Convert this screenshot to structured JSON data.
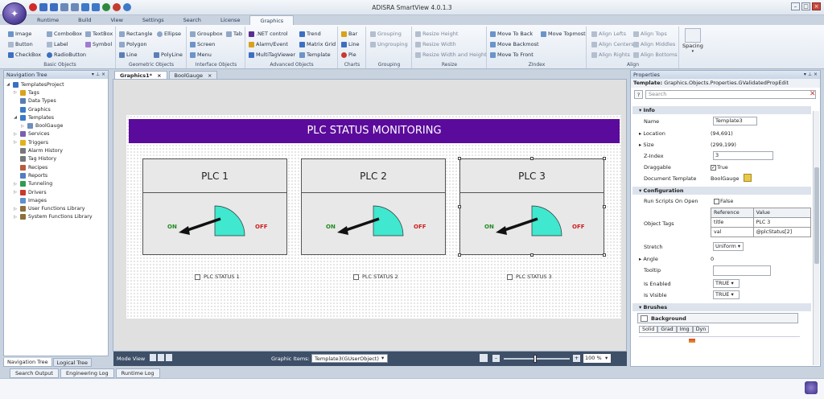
{
  "window": {
    "title": "ADISRA SmartView 4.0.1.3"
  },
  "ribbon_tabs": [
    {
      "label": "Runtime"
    },
    {
      "label": "Build"
    },
    {
      "label": "View"
    },
    {
      "label": "Settings"
    },
    {
      "label": "Search"
    },
    {
      "label": "License"
    },
    {
      "label": "Graphics"
    }
  ],
  "ribbon": {
    "basic": {
      "label": "Basic Objects",
      "items": [
        "Image",
        "ComboBox",
        "TextBox",
        "Button",
        "Label",
        "Symbol",
        "CheckBox",
        "RadioButton"
      ]
    },
    "geometric": {
      "label": "Geometric Objects",
      "items": [
        "Rectangle",
        "Ellipse",
        "Polygon",
        "Line",
        "PolyLine"
      ]
    },
    "interface": {
      "label": "Interface Objects",
      "items": [
        "Groupbox",
        "Tab",
        "Screen",
        "Menu"
      ]
    },
    "advanced": {
      "label": "Advanced Objects",
      "items": [
        ".NET control",
        "Trend",
        "Alarm/Event",
        "Matrix Grid",
        "MultiTagViewer",
        "Template"
      ]
    },
    "charts": {
      "label": "Charts",
      "items": [
        "Bar",
        "Line",
        "Pie"
      ]
    },
    "grouping": {
      "label": "Grouping",
      "items": [
        "Grouping",
        "Ungrouping"
      ]
    },
    "resize": {
      "label": "Resize",
      "items": [
        "Resize Height",
        "Resize Width",
        "Resize Width and Height"
      ]
    },
    "zindex": {
      "label": "ZIndex",
      "items": [
        "Move To Back",
        "Move Topmost",
        "Move Backmost",
        "Move To Front"
      ]
    },
    "align": {
      "label": "Align",
      "items": [
        "Align Lefts",
        "Align Tops",
        "Align Centers",
        "Align Middles",
        "Align Rights",
        "Align Bottoms"
      ]
    },
    "spacing": {
      "label": "Spacing"
    }
  },
  "nav_tree": {
    "title": "Navigation Tree",
    "items": [
      {
        "label": "TemplatesProject",
        "level": 0,
        "color": "#3b6fc4"
      },
      {
        "label": "Tags",
        "level": 1,
        "color": "#d9a21c"
      },
      {
        "label": "Data Types",
        "level": 1,
        "color": "#5a7db0"
      },
      {
        "label": "Graphics",
        "level": 1,
        "color": "#3a7ac8"
      },
      {
        "label": "Templates",
        "level": 1,
        "color": "#3a7ac8"
      },
      {
        "label": "BoolGauge",
        "level": 2,
        "color": "#6d8fc0"
      },
      {
        "label": "Services",
        "level": 1,
        "color": "#7a5fb0"
      },
      {
        "label": "Triggers",
        "level": 1,
        "color": "#e2b21a"
      },
      {
        "label": "Alarm History",
        "level": 1,
        "color": "#777777"
      },
      {
        "label": "Tag History",
        "level": 1,
        "color": "#777777"
      },
      {
        "label": "Recipes",
        "level": 1,
        "color": "#b85c3c"
      },
      {
        "label": "Reports",
        "level": 1,
        "color": "#4f7fbd"
      },
      {
        "label": "Tunneling",
        "level": 1,
        "color": "#2f9c4f"
      },
      {
        "label": "Drivers",
        "level": 1,
        "color": "#c8392d"
      },
      {
        "label": "Images",
        "level": 1,
        "color": "#5e8fd0"
      },
      {
        "label": "User Functions Library",
        "level": 1,
        "color": "#8c6f3a"
      },
      {
        "label": "System Functions Library",
        "level": 1,
        "color": "#8c6f3a"
      }
    ],
    "tabs": [
      "Navigation Tree",
      "Logical Tree"
    ]
  },
  "doc_tabs": [
    "Graphics1*",
    "BoolGauge"
  ],
  "canvas": {
    "banner": "PLC STATUS MONITORING",
    "plcs": [
      {
        "name": "PLC 1",
        "checkbox": "PLC STATUS 1"
      },
      {
        "name": "PLC 2",
        "checkbox": "PLC STATUS 2"
      },
      {
        "name": "PLC 3",
        "checkbox": "PLC STATUS 3"
      }
    ],
    "on_label": "ON",
    "off_label": "OFF",
    "gauge_color": "#3fe8cf"
  },
  "statusbar": {
    "mode_view": "Mode View",
    "graphic_items_label": "Graphic Items:",
    "graphic_items_value": "Template3(GUserObject)",
    "zoom": "100 %",
    "zoom_level": 0.45
  },
  "bottom_tabs": [
    "Search Output",
    "Engineering Log",
    "Runtime Log"
  ],
  "properties": {
    "title": "Properties",
    "template_label": "Template:",
    "template_type": "Graphics.Objects.Properties.GValidatedPropEdit",
    "search_placeholder": "Search",
    "info": {
      "header": "Info",
      "name_label": "Name",
      "name_value": "Template3",
      "location_label": "Location",
      "location_value": "(94,691)",
      "size_label": "Size",
      "size_value": "(299,199)",
      "zindex_label": "Z-Index",
      "zindex_value": "3",
      "draggable_label": "Draggable",
      "draggable_value": "True",
      "doc_template_label": "Document Template",
      "doc_template_value": "BoolGauge"
    },
    "configuration": {
      "header": "Configuration",
      "scripts_label": "Run Scripts On Open",
      "scripts_value": "False",
      "object_tags_label": "Object Tags",
      "object_tags_headers": [
        "Reference",
        "Value"
      ],
      "object_tags_rows": [
        [
          "title",
          "PLC 3"
        ],
        [
          "val",
          "@plcStatus[2]"
        ]
      ],
      "stretch_label": "Stretch",
      "stretch_value": "Uniform",
      "angle_label": "Angle",
      "angle_value": "0",
      "tooltip_label": "Tooltip",
      "enabled_label": "Is Enabled",
      "enabled_value": "TRUE",
      "visible_label": "Is Visible",
      "visible_value": "TRUE"
    },
    "brushes": {
      "header": "Brushes",
      "background_label": "Background",
      "tabs": [
        "Solid",
        "Grad",
        "Img",
        "Dyn"
      ]
    }
  },
  "colors": {
    "accent": "#5b0b9b",
    "ribbon_bg": "#e2e9f2",
    "statusbar": "#3e4f68"
  }
}
